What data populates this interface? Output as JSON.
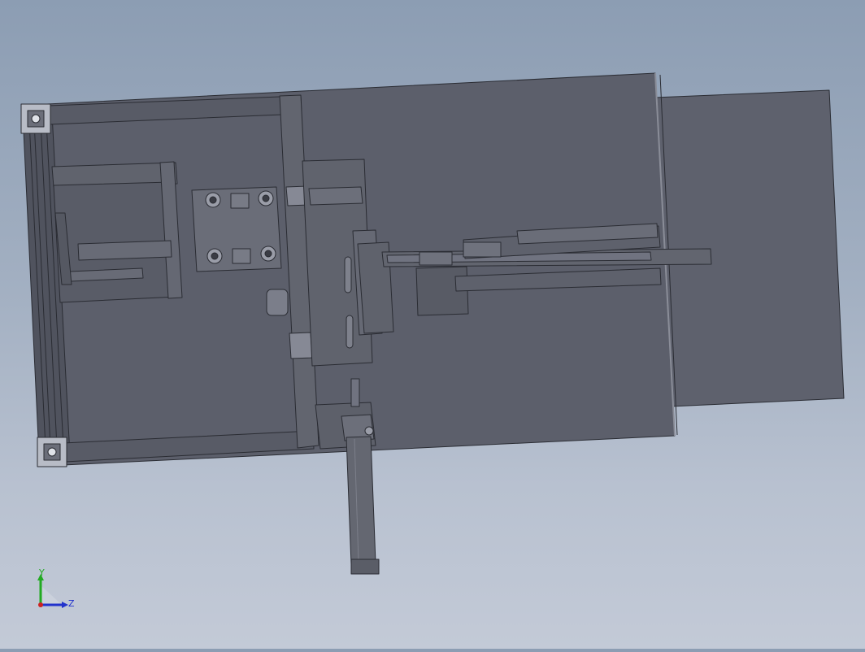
{
  "viewport": {
    "background_top": "#8c9db3",
    "background_bottom": "#c3cad7",
    "model_face_color": "#5c5f6b",
    "model_edge_color": "#2a2c33",
    "model_highlight_color": "#7b7e8a"
  },
  "triad": {
    "y_label": "Y",
    "z_label": "Z",
    "y_color": "#22aa22",
    "z_color": "#2233cc",
    "x_color": "#cc2222"
  }
}
